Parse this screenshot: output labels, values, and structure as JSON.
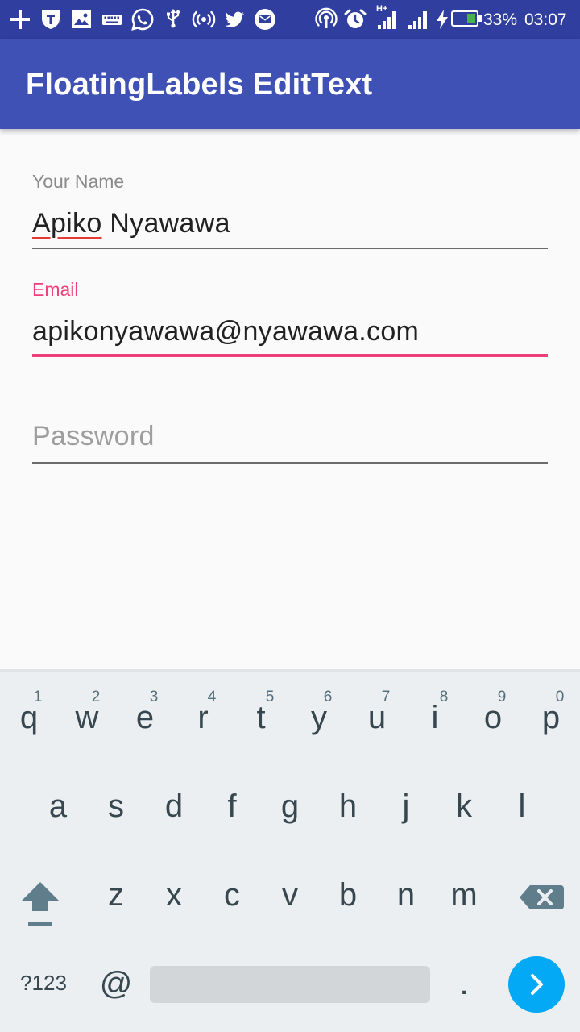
{
  "status_bar": {
    "battery_percent": "33%",
    "time": "03:07",
    "network_label": "H+",
    "icons": [
      "plus-icon",
      "shield-icon",
      "image-icon",
      "keyboard-icon",
      "whatsapp-icon",
      "usb-icon",
      "hotspot-icon",
      "twitter-icon",
      "email-icon",
      "podcast-icon",
      "alarm-icon",
      "signal-icon",
      "signal-icon",
      "charging-icon",
      "battery-icon"
    ],
    "battery_level": 0.33,
    "battery_color": "#4caf50"
  },
  "app_bar": {
    "title": "FloatingLabels EditText",
    "color": "#3f51b5"
  },
  "form": {
    "name": {
      "label": "Your Name",
      "value_word1": "Apiko",
      "value_word2": " Nyawawa"
    },
    "email": {
      "label": "Email",
      "value": "apikonyawawa@nyawawa.com",
      "accent": "#ec407a"
    },
    "password": {
      "placeholder": "Password",
      "value": ""
    }
  },
  "keyboard": {
    "row1": [
      {
        "key": "q",
        "hint": "1"
      },
      {
        "key": "w",
        "hint": "2"
      },
      {
        "key": "e",
        "hint": "3"
      },
      {
        "key": "r",
        "hint": "4"
      },
      {
        "key": "t",
        "hint": "5"
      },
      {
        "key": "y",
        "hint": "6"
      },
      {
        "key": "u",
        "hint": "7"
      },
      {
        "key": "i",
        "hint": "8"
      },
      {
        "key": "o",
        "hint": "9"
      },
      {
        "key": "p",
        "hint": "0"
      }
    ],
    "row2": [
      "a",
      "s",
      "d",
      "f",
      "g",
      "h",
      "j",
      "k",
      "l"
    ],
    "row3": [
      "z",
      "x",
      "c",
      "v",
      "b",
      "n",
      "m"
    ],
    "symbols_label": "?123",
    "at_label": "@",
    "period_label": ".",
    "icons": [
      "shift-icon",
      "backspace-icon",
      "chevron-right-icon"
    ],
    "enter_color": "#03a9f4"
  }
}
